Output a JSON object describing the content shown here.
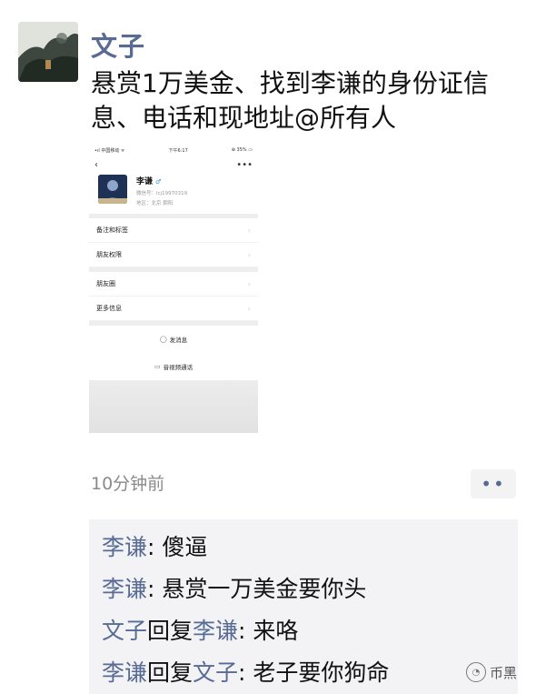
{
  "post": {
    "username": "文子",
    "text": "悬赏1万美金、找到李谦的身份证信息、电话和现地址@所有人",
    "time_ago": "10分钟前",
    "more_glyph": "••"
  },
  "embedded_screenshot": {
    "status_left": "•ıl 中国移动 ᯤ",
    "status_center": "下午6:17",
    "status_right": "⊕ 35% ▭",
    "back_glyph": "‹",
    "more_glyph": "•••",
    "profile": {
      "name": "李谦",
      "gender_glyph": "♂",
      "wechat_id": "微信号：lcj19970319",
      "region": "地区：北京 朝阳"
    },
    "rows": [
      {
        "label": "备注和标签",
        "chevron": "›"
      },
      {
        "label": "朋友权限",
        "chevron": "›"
      },
      {
        "label": "朋友圈",
        "chevron": "›"
      },
      {
        "label": "更多信息",
        "chevron": "›"
      }
    ],
    "send_message": "发消息",
    "send_message_icon": "◯",
    "video_call": "音视频通话",
    "video_call_icon": "▭"
  },
  "comments": [
    {
      "from": "李谦",
      "reply_word": "",
      "to": "",
      "sep": ": ",
      "text": "傻逼"
    },
    {
      "from": "李谦",
      "reply_word": "",
      "to": "",
      "sep": ": ",
      "text": "悬赏一万美金要你头"
    },
    {
      "from": "文子",
      "reply_word": "回复",
      "to": "李谦",
      "sep": ": ",
      "text": "来咯"
    },
    {
      "from": "李谦",
      "reply_word": "回复",
      "to": "文子",
      "sep": ": ",
      "text": "老子要你狗命"
    }
  ],
  "watermark": {
    "icon": "◔",
    "text": "币黑"
  }
}
